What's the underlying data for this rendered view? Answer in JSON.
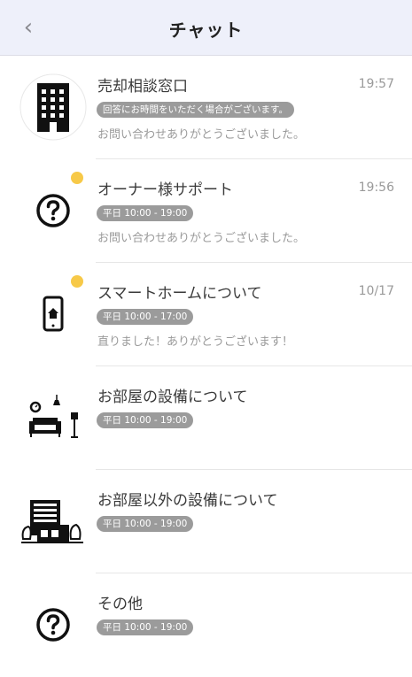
{
  "header": {
    "title": "チャット",
    "back_icon": "chevron-left-icon"
  },
  "rows": [
    {
      "name": "売却相談窓口",
      "time": "19:57",
      "badge": "回答にお時間をいただく場合がございます。",
      "message": "お問い合わせありがとうございました。",
      "icon": "building-icon",
      "unread": false
    },
    {
      "name": "オーナー様サポート",
      "time": "19:56",
      "badge": "平日 10:00 - 19:00",
      "message": "お問い合わせありがとうございました。",
      "icon": "question-icon",
      "unread": true
    },
    {
      "name": "スマートホームについて",
      "time": "10/17",
      "badge": "平日 10:00 - 17:00",
      "message": "直りました！ありがとうございます！",
      "icon": "smartphone-home-icon",
      "unread": true
    },
    {
      "name": "お部屋の設備について",
      "time": "",
      "badge": "平日 10:00 - 19:00",
      "message": "",
      "icon": "living-room-icon",
      "unread": false
    },
    {
      "name": "お部屋以外の設備について",
      "time": "",
      "badge": "平日 10:00 - 19:00",
      "message": "",
      "icon": "facility-building-icon",
      "unread": false
    },
    {
      "name": "その他",
      "time": "",
      "badge": "平日 10:00 - 19:00",
      "message": "",
      "icon": "question-icon",
      "unread": false
    }
  ],
  "colors": {
    "header_bg": "#eef0fa",
    "unread_dot": "#f7c948",
    "badge_bg": "#9b9b9b"
  }
}
